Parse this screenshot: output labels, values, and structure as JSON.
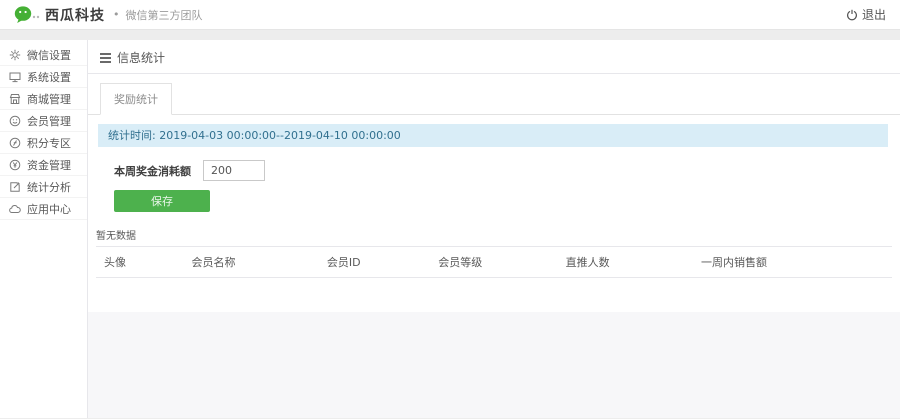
{
  "header": {
    "brand": "西瓜科技",
    "separator": "•",
    "subtitle": "微信第三方团队",
    "logout_label": "退出"
  },
  "sidebar": {
    "items": [
      {
        "label": "微信设置",
        "icon": "gear-icon"
      },
      {
        "label": "系统设置",
        "icon": "desktop-icon"
      },
      {
        "label": "商城管理",
        "icon": "store-icon"
      },
      {
        "label": "会员管理",
        "icon": "member-icon"
      },
      {
        "label": "积分专区",
        "icon": "points-icon"
      },
      {
        "label": "资金管理",
        "icon": "money-icon"
      },
      {
        "label": "统计分析",
        "icon": "stats-icon"
      },
      {
        "label": "应用中心",
        "icon": "cloud-icon"
      }
    ]
  },
  "main": {
    "page_title": "信息统计",
    "tabs": [
      {
        "label": "奖励统计",
        "active": true
      }
    ],
    "info_bar": "统计时间: 2019-04-03 00:00:00--2019-04-10 00:00:00",
    "form": {
      "label": "本周奖金消耗额",
      "value": "200",
      "save_label": "保存"
    },
    "empty_text": "暂无数据",
    "table": {
      "headers": [
        "头像",
        "会员名称",
        "会员ID",
        "会员等级",
        "直推人数",
        "一周内销售额"
      ],
      "rows": []
    }
  },
  "colors": {
    "accent_green": "#4db14d",
    "wechat_green": "#45b035",
    "info_bg": "#d9edf7",
    "info_text": "#31708f"
  }
}
